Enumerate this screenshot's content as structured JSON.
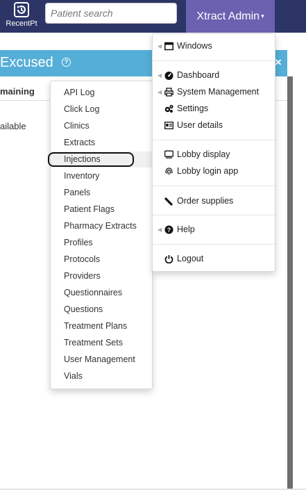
{
  "navbar": {
    "recent_label": "RecentPt",
    "search_placeholder": "Patient search",
    "admin_label": "Xtract Admin"
  },
  "modal": {
    "title": "Excused",
    "column_header": "maining",
    "cell_text": "ailable",
    "close_symbol": "×"
  },
  "submenu": {
    "items": [
      {
        "label": "API Log"
      },
      {
        "label": "Click Log"
      },
      {
        "label": "Clinics"
      },
      {
        "label": "Extracts"
      },
      {
        "label": "Injections"
      },
      {
        "label": "Inventory"
      },
      {
        "label": "Panels"
      },
      {
        "label": "Patient Flags"
      },
      {
        "label": "Pharmacy Extracts"
      },
      {
        "label": "Profiles"
      },
      {
        "label": "Protocols"
      },
      {
        "label": "Providers"
      },
      {
        "label": "Questionnaires"
      },
      {
        "label": "Questions"
      },
      {
        "label": "Treatment Plans"
      },
      {
        "label": "Treatment Sets"
      },
      {
        "label": "User Management"
      },
      {
        "label": "Vials"
      }
    ],
    "highlighted": "Injections"
  },
  "admin_menu": {
    "windows": "Windows",
    "dashboard": "Dashboard",
    "system_management": "System Management",
    "settings": "Settings",
    "user_details": "User details",
    "lobby_display": "Lobby display",
    "lobby_login_app": "Lobby login app",
    "order_supplies": "Order supplies",
    "help": "Help",
    "logout": "Logout"
  },
  "colors": {
    "navbar": "#2c3566",
    "admin_button": "#6a62b0",
    "modal_header": "#55aed7"
  }
}
